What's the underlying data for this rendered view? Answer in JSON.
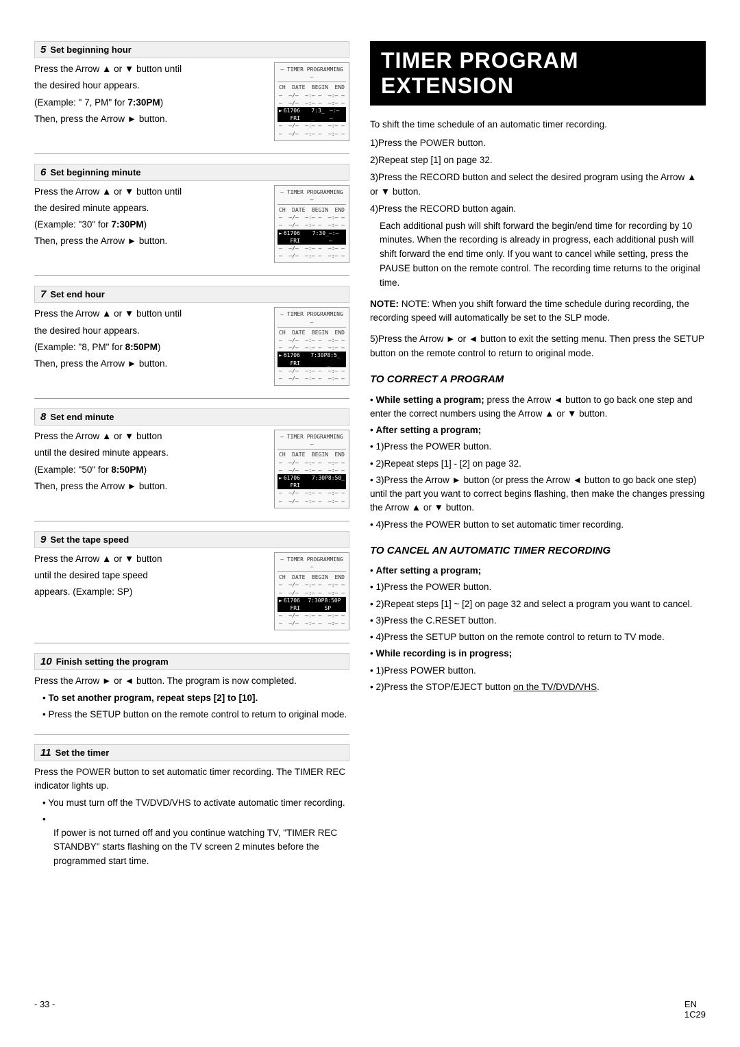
{
  "left": {
    "steps": [
      {
        "id": "step5",
        "num": "5",
        "title": "Set beginning hour",
        "text_lines": [
          "Press the Arrow ▲ or ▼ button until",
          "the desired hour appears.",
          "(Example: \" 7, PM\" for 7:30PM)",
          "Then, press the Arrow ► button."
        ],
        "screen": {
          "title": "– TIMER PROGRAMMING –",
          "headers": [
            "CH",
            "DATE",
            "BEGIN",
            "END"
          ],
          "rows": [
            {
              "cols": [
                "–",
                "–/–",
                "–:– –",
                "–:– –"
              ],
              "highlight": false
            },
            {
              "cols": [
                "–",
                "–/–",
                "–:– –",
                "–:– –"
              ],
              "highlight": false
            },
            {
              "cols": [
                "61",
                "706 FRI",
                "7:3_ _",
                "–:– –"
              ],
              "highlight": true,
              "arrow": true
            },
            {
              "cols": [
                "–",
                "–/–",
                "–:– –",
                "–:– –"
              ],
              "highlight": false
            },
            {
              "cols": [
                "–",
                "–/–",
                "–:– –",
                "–:– –"
              ],
              "highlight": false
            }
          ]
        }
      },
      {
        "id": "step6",
        "num": "6",
        "title": "Set beginning minute",
        "text_lines": [
          "Press the Arrow ▲ or ▼ button until",
          "the desired minute appears.",
          "(Example: \"30\" for 7:30PM)",
          "Then, press the Arrow ► button."
        ],
        "screen": {
          "title": "– TIMER PROGRAMMING –",
          "headers": [
            "CH",
            "DATE",
            "BEGIN",
            "END"
          ],
          "rows": [
            {
              "cols": [
                "–",
                "–/–",
                "–:– –",
                "–:– –"
              ],
              "highlight": false
            },
            {
              "cols": [
                "–",
                "–/–",
                "–:– –",
                "–:– –"
              ],
              "highlight": false
            },
            {
              "cols": [
                "61",
                "706 FRI",
                "7:30_",
                "–:– –"
              ],
              "highlight": true,
              "arrow": true
            },
            {
              "cols": [
                "–",
                "–/–",
                "–:– –",
                "–:– –"
              ],
              "highlight": false
            },
            {
              "cols": [
                "–",
                "–/–",
                "–:– –",
                "–:– –"
              ],
              "highlight": false
            }
          ]
        }
      },
      {
        "id": "step7",
        "num": "7",
        "title": "Set end hour",
        "text_lines": [
          "Press the Arrow ▲ or ▼ button until",
          "the desired hour appears.",
          "(Example: \"8, PM\" for 8:50PM)",
          "Then, press the Arrow ► button."
        ],
        "screen": {
          "title": "– TIMER PROGRAMMING –",
          "headers": [
            "CH",
            "DATE",
            "BEGIN",
            "END"
          ],
          "rows": [
            {
              "cols": [
                "–",
                "–/–",
                "–:– –",
                "–:– –"
              ],
              "highlight": false
            },
            {
              "cols": [
                "–",
                "–/–",
                "–:– –",
                "–:– –"
              ],
              "highlight": false
            },
            {
              "cols": [
                "61",
                "706 FRI",
                "7:30P",
                "8:5_ _"
              ],
              "highlight": true,
              "arrow": true
            },
            {
              "cols": [
                "–",
                "–/–",
                "–:– –",
                "–:– –"
              ],
              "highlight": false
            },
            {
              "cols": [
                "–",
                "–/–",
                "–:– –",
                "–:– –"
              ],
              "highlight": false
            }
          ]
        }
      },
      {
        "id": "step8",
        "num": "8",
        "title": "Set end minute",
        "text_lines": [
          "Press the Arrow ▲ or ▼ button",
          "until the desired minute appears.",
          "(Example: \"50\" for 8:50PM)",
          "Then, press the Arrow ► button."
        ],
        "screen": {
          "title": "– TIMER PROGRAMMING –",
          "headers": [
            "CH",
            "DATE",
            "BEGIN",
            "END"
          ],
          "rows": [
            {
              "cols": [
                "–",
                "–/–",
                "–:– –",
                "–:– –"
              ],
              "highlight": false
            },
            {
              "cols": [
                "–",
                "–/–",
                "–:– –",
                "–:– –"
              ],
              "highlight": false
            },
            {
              "cols": [
                "61",
                "706 FRI",
                "7:30P",
                "8:50_"
              ],
              "highlight": true,
              "arrow": true
            },
            {
              "cols": [
                "–",
                "–/–",
                "–:– –",
                "–:– –"
              ],
              "highlight": false
            },
            {
              "cols": [
                "–",
                "–/–",
                "–:– –",
                "–:– –"
              ],
              "highlight": false
            }
          ]
        }
      },
      {
        "id": "step9",
        "num": "9",
        "title": "Set the tape speed",
        "text_lines": [
          "Press the Arrow ▲ or ▼ button",
          "until the desired tape speed",
          "appears. (Example: SP)"
        ],
        "screen": {
          "title": "– TIMER PROGRAMMING –",
          "headers": [
            "CH",
            "DATE",
            "BEGIN",
            "END"
          ],
          "rows": [
            {
              "cols": [
                "–",
                "–/–",
                "–:– –",
                "–:– –"
              ],
              "highlight": false
            },
            {
              "cols": [
                "–",
                "–/–",
                "–:– –",
                "–:– –"
              ],
              "highlight": false
            },
            {
              "cols": [
                "61",
                "706 FRI",
                "7:30P",
                "8:50P SP"
              ],
              "highlight": true,
              "arrow": true
            },
            {
              "cols": [
                "–",
                "–/–",
                "–:– –",
                "–:– –"
              ],
              "highlight": false
            },
            {
              "cols": [
                "–",
                "–/–",
                "–:– –",
                "–:– –"
              ],
              "highlight": false
            }
          ]
        }
      }
    ],
    "step10": {
      "num": "10",
      "title": "Finish setting the program",
      "text": "Press the Arrow ► or ◄ button. The program is now completed.",
      "bullets": [
        "To set another program, repeat steps [2] to [10].",
        "Press the SETUP button on the remote control to return to original mode."
      ]
    },
    "step11": {
      "num": "11",
      "title": "Set the timer",
      "text": "Press the POWER button to set automatic timer recording. The TIMER REC indicator lights up.",
      "bullets": [
        "You must turn off the TV/DVD/VHS to activate automatic timer recording.",
        "If power is not turned off and you continue watching TV, \"TIMER REC STANDBY\" starts flashing on the TV screen 2 minutes before the programmed start time."
      ]
    }
  },
  "right": {
    "title": "TIMER PROGRAM EXTENSION",
    "intro": "To shift the time schedule of an automatic timer recording.",
    "steps": [
      "1)Press the POWER button.",
      "2)Repeat step [1] on page 32.",
      "3)Press the RECORD button and select the desired program using the Arrow ▲ or ▼ button.",
      "4)Press the RECORD button again."
    ],
    "paragraph1": "Each additional push will shift forward the begin/end time for recording by 10 minutes. When the recording is already in progress, each additional push will shift forward the end time only. If you want to cancel while setting, press the PAUSE button on the remote control. The recording time returns to the original time.",
    "note": "NOTE: When you shift forward the time schedule during recording, the recording speed will automatically be set to the SLP mode.",
    "step5": "5)Press the Arrow ► or ◄ button to exit the setting menu. Then press the SETUP button on the remote control to return to original mode.",
    "correct_title": "TO CORRECT A PROGRAM",
    "correct_bullets": [
      {
        "bold": "While setting a program;",
        "text": " press the Arrow ◄ button to go back one step and enter the correct numbers using the Arrow ▲ or ▼ button."
      },
      {
        "bold": "After setting a program;",
        "text": ""
      }
    ],
    "after_setting_steps": [
      "1)Press the POWER button.",
      "2)Repeat steps [1] - [2] on page 32.",
      "3)Press the Arrow ► button (or press the Arrow ◄ button to go back one step) until the part you want to correct begins flashing, then make the changes pressing the Arrow ▲ or ▼ button.",
      "4)Press the POWER button to set automatic timer recording."
    ],
    "cancel_title": "TO CANCEL AN AUTOMATIC TIMER RECORDING",
    "cancel_after_bold": "After setting a program;",
    "cancel_steps": [
      "1)Press the POWER button.",
      "2)Repeat steps [1] ~ [2] on page 32 and select a program you want to cancel.",
      "3)Press the C.RESET button.",
      "4)Press the SETUP button on the remote control to return to TV mode."
    ],
    "while_recording_bold": "While recording is in progress;",
    "while_steps": [
      "1)Press POWER button.",
      "2)Press the STOP/EJECT button on the TV/DVD/VHS."
    ],
    "underline_text": "on the TV/DVD/VHS"
  },
  "footer": {
    "page_num": "- 33 -",
    "lang": "EN",
    "code": "1C29"
  }
}
